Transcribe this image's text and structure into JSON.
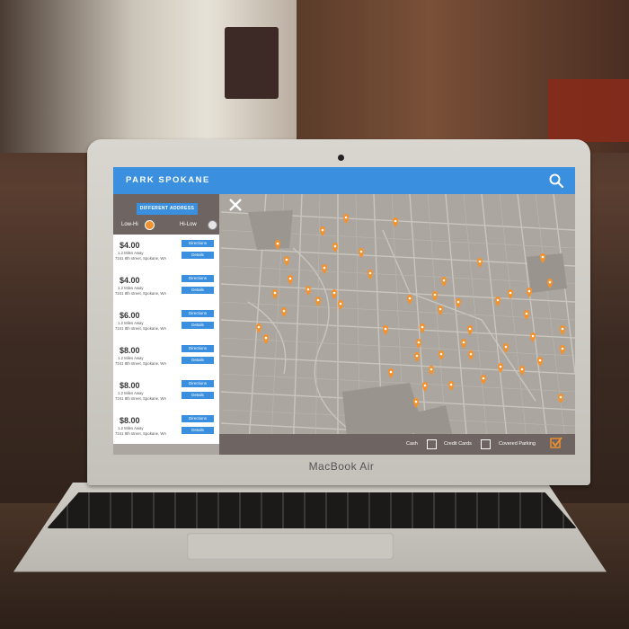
{
  "device": {
    "brand_label": "MacBook Air"
  },
  "app": {
    "title": "PARK SPOKANE",
    "accent_color": "#3a8fde",
    "marker_color": "#f2922e",
    "header_icons": [
      "search-icon"
    ]
  },
  "panel": {
    "different_address_label": "DIFFERENT ADDRESS",
    "sort_low_label": "Low-Hi",
    "sort_high_label": "Hi-Low",
    "sort_selected": "Low-Hi",
    "close_icon": "close-icon",
    "listings": [
      {
        "price": "$4.00",
        "distance": "1.2 Miles Away",
        "address": "7241 8th street, Spokane, WA",
        "directions_label": "Directions",
        "details_label": "Details"
      },
      {
        "price": "$4.00",
        "distance": "1.2 Miles Away",
        "address": "7241 8th street, Spokane, WA",
        "directions_label": "Directions",
        "details_label": "Details"
      },
      {
        "price": "$6.00",
        "distance": "1.2 Miles Away",
        "address": "7241 8th street, Spokane, WA",
        "directions_label": "Directions",
        "details_label": "Details"
      },
      {
        "price": "$8.00",
        "distance": "1.2 Miles Away",
        "address": "7241 8th street, Spokane, WA",
        "directions_label": "Directions",
        "details_label": "Details"
      },
      {
        "price": "$8.00",
        "distance": "1.2 Miles Away",
        "address": "7241 8th street, Spokane, WA",
        "directions_label": "Directions",
        "details_label": "Details"
      },
      {
        "price": "$8.00",
        "distance": "1.2 Miles Away",
        "address": "7241 8th street, Spokane, WA",
        "directions_label": "Directions",
        "details_label": "Details"
      }
    ]
  },
  "filters": {
    "cash_label": "Cash",
    "cash_checked": false,
    "credit_label": "Credit Cards",
    "credit_checked": false,
    "covered_label": "Covered Parking",
    "covered_checked": true
  }
}
